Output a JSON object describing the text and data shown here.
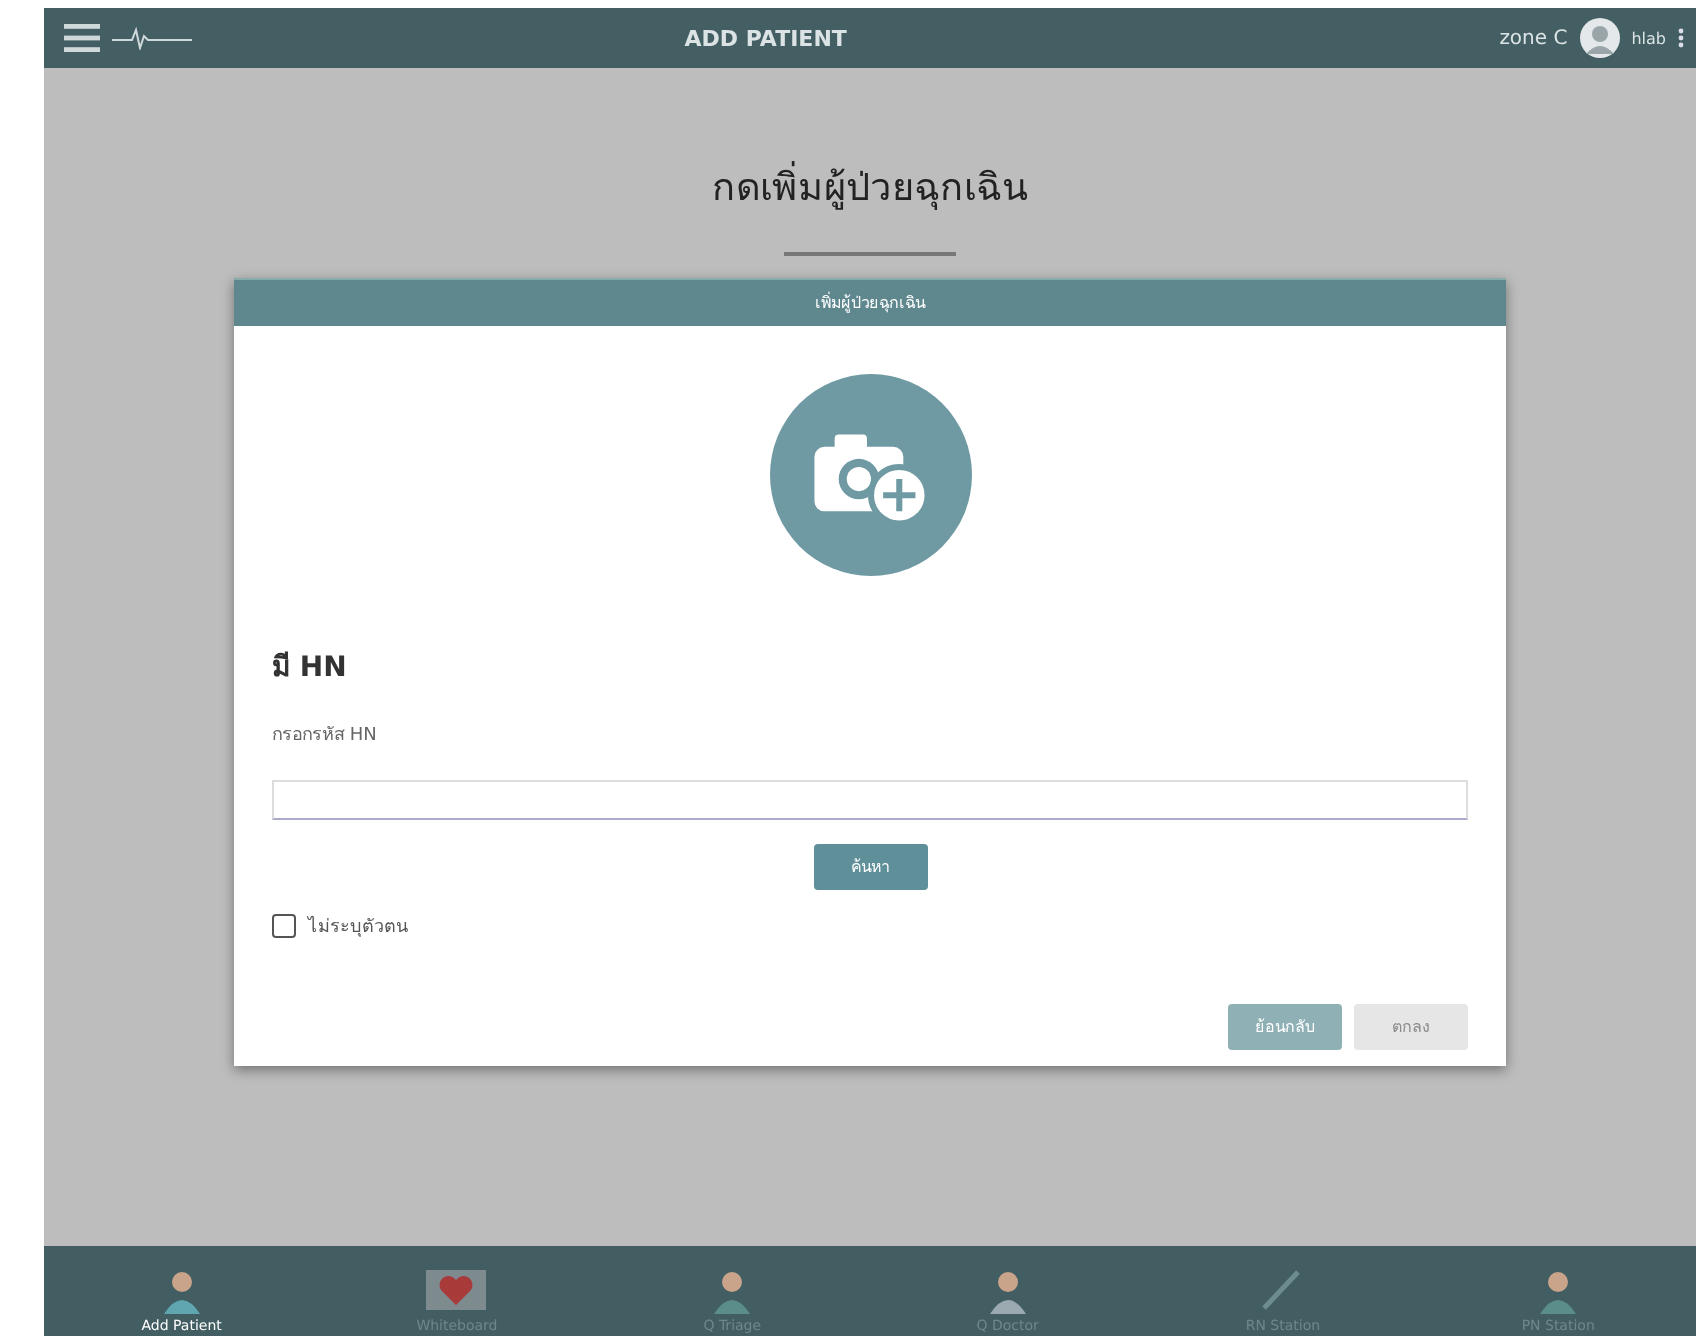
{
  "header": {
    "title": "ADD PATIENT",
    "zone": "zone C",
    "user": "hlab"
  },
  "page": {
    "heading": "กดเพิ่มผู้ป่วยฉุกเฉิน"
  },
  "dialog": {
    "title": "เพิ่มผู้ป่วยฉุกเฉิน",
    "section": "มี HN",
    "field_label": "กรอกรหัส HN",
    "search_button": "ค้นหา",
    "anonymous": {
      "label": "ไม่ระบุตัวตน",
      "checked": false
    },
    "buttons": [
      {
        "label": "ย้อนกลับ",
        "disabled": false
      },
      {
        "label": "ตกลง",
        "disabled": true
      }
    ]
  },
  "bottom_nav": [
    {
      "label": "Add Patient",
      "kind": "patient",
      "selected": true
    },
    {
      "label": "Whiteboard",
      "kind": "monitor",
      "selected": false
    },
    {
      "label": "Q Triage",
      "kind": "nurse",
      "selected": false
    },
    {
      "label": "Q Doctor",
      "kind": "doctor",
      "selected": false
    },
    {
      "label": "RN Station",
      "kind": "syringe",
      "selected": false
    },
    {
      "label": "PN Station",
      "kind": "nurse",
      "selected": false
    }
  ]
}
